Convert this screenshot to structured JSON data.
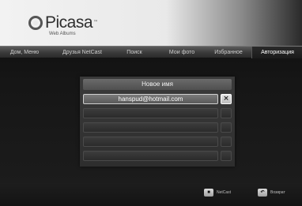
{
  "logo": {
    "name": "Picasa",
    "tm": "™",
    "subtitle": "Web Albums"
  },
  "tabs": [
    {
      "label": "Дом, Меню",
      "active": false
    },
    {
      "label": "Друзья NetCast",
      "active": false
    },
    {
      "label": "Поиск",
      "active": false
    },
    {
      "label": "Мои фото",
      "active": false
    },
    {
      "label": "Избранное",
      "active": false
    },
    {
      "label": "Авторизация",
      "active": true
    }
  ],
  "dialog": {
    "title": "Новое имя",
    "accounts": [
      {
        "email": "hanspud@hotmail.com",
        "selected": true,
        "delete_icon": "×"
      },
      {
        "email": "",
        "selected": false,
        "delete_icon": ""
      },
      {
        "email": "",
        "selected": false,
        "delete_icon": ""
      },
      {
        "email": "",
        "selected": false,
        "delete_icon": ""
      },
      {
        "email": "",
        "selected": false,
        "delete_icon": ""
      }
    ]
  },
  "footer": {
    "netcast": {
      "key": "■",
      "label": "NetCast"
    },
    "back": {
      "key": "↶",
      "label": "Возврат"
    }
  },
  "colors": {
    "selected_row": "#6a6a6a",
    "header_bg": "#ececec",
    "background": "#161616"
  }
}
